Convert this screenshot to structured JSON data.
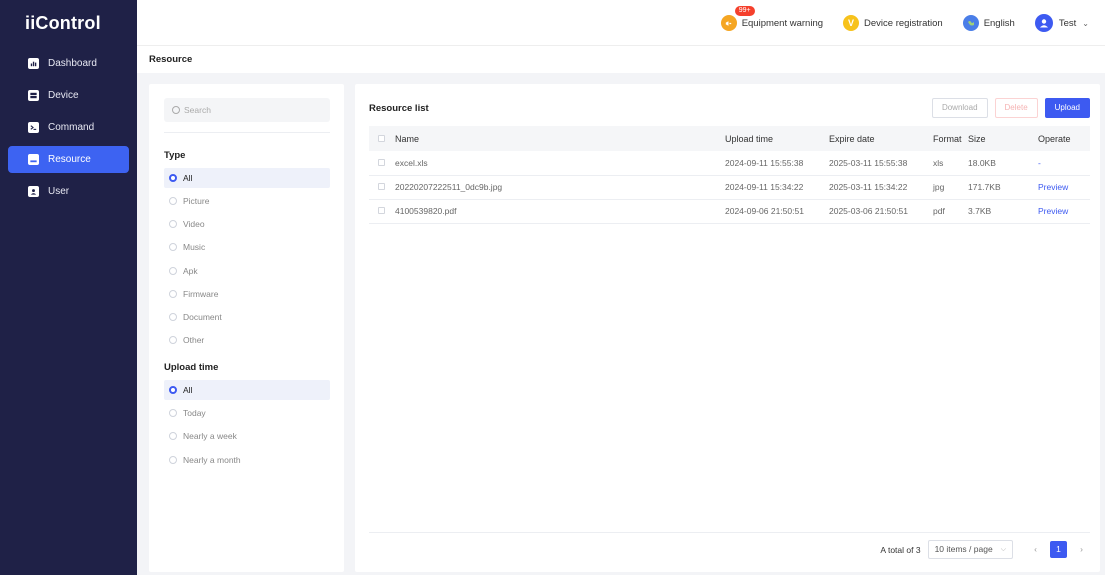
{
  "app": {
    "title": "iiControl"
  },
  "sidebar": {
    "items": [
      {
        "label": "Dashboard",
        "icon": "dashboard-icon"
      },
      {
        "label": "Device",
        "icon": "device-icon"
      },
      {
        "label": "Command",
        "icon": "command-icon"
      },
      {
        "label": "Resource",
        "icon": "resource-icon",
        "active": true
      },
      {
        "label": "User",
        "icon": "user-icon"
      }
    ]
  },
  "header": {
    "warning_label": "Equipment warning",
    "warning_badge": "99+",
    "registration_label": "Device registration",
    "language_label": "English",
    "user_name": "Test",
    "user_dropdown": "⌄"
  },
  "breadcrumb": {
    "current": "Resource"
  },
  "filter": {
    "search_placeholder": "Search",
    "type_title": "Type",
    "type_options": [
      "All",
      "Picture",
      "Video",
      "Music",
      "Apk",
      "Firmware",
      "Document",
      "Other"
    ],
    "type_selected": "All",
    "upload_time_title": "Upload time",
    "upload_time_options": [
      "All",
      "Today",
      "Nearly a week",
      "Nearly a month"
    ],
    "upload_time_selected": "All"
  },
  "list": {
    "title": "Resource list",
    "download_label": "Download",
    "delete_label": "Delete",
    "upload_label": "Upload",
    "columns": [
      "Name",
      "Upload time",
      "Expire date",
      "Format",
      "Size",
      "Operate"
    ],
    "rows": [
      {
        "name": "excel.xls",
        "upload_time": "2024-09-11 15:55:38",
        "expire_date": "2025-03-11 15:55:38",
        "format": "xls",
        "size": "18.0KB",
        "operate": "-"
      },
      {
        "name": "20220207222511_0dc9b.jpg",
        "upload_time": "2024-09-11 15:34:22",
        "expire_date": "2025-03-11 15:34:22",
        "format": "jpg",
        "size": "171.7KB",
        "operate": "Preview"
      },
      {
        "name": "4100539820.pdf",
        "upload_time": "2024-09-06 21:50:51",
        "expire_date": "2025-03-06 21:50:51",
        "format": "pdf",
        "size": "3.7KB",
        "operate": "Preview"
      }
    ]
  },
  "pagination": {
    "total_text": "A total of 3",
    "page_size_label": "10 items / page",
    "prev": "‹",
    "current_page": "1",
    "next": "›"
  },
  "colors": {
    "primary": "#3d5af1",
    "sidebar_bg": "#1f2147",
    "warning": "#f5a623",
    "danger": "#f5402c"
  }
}
